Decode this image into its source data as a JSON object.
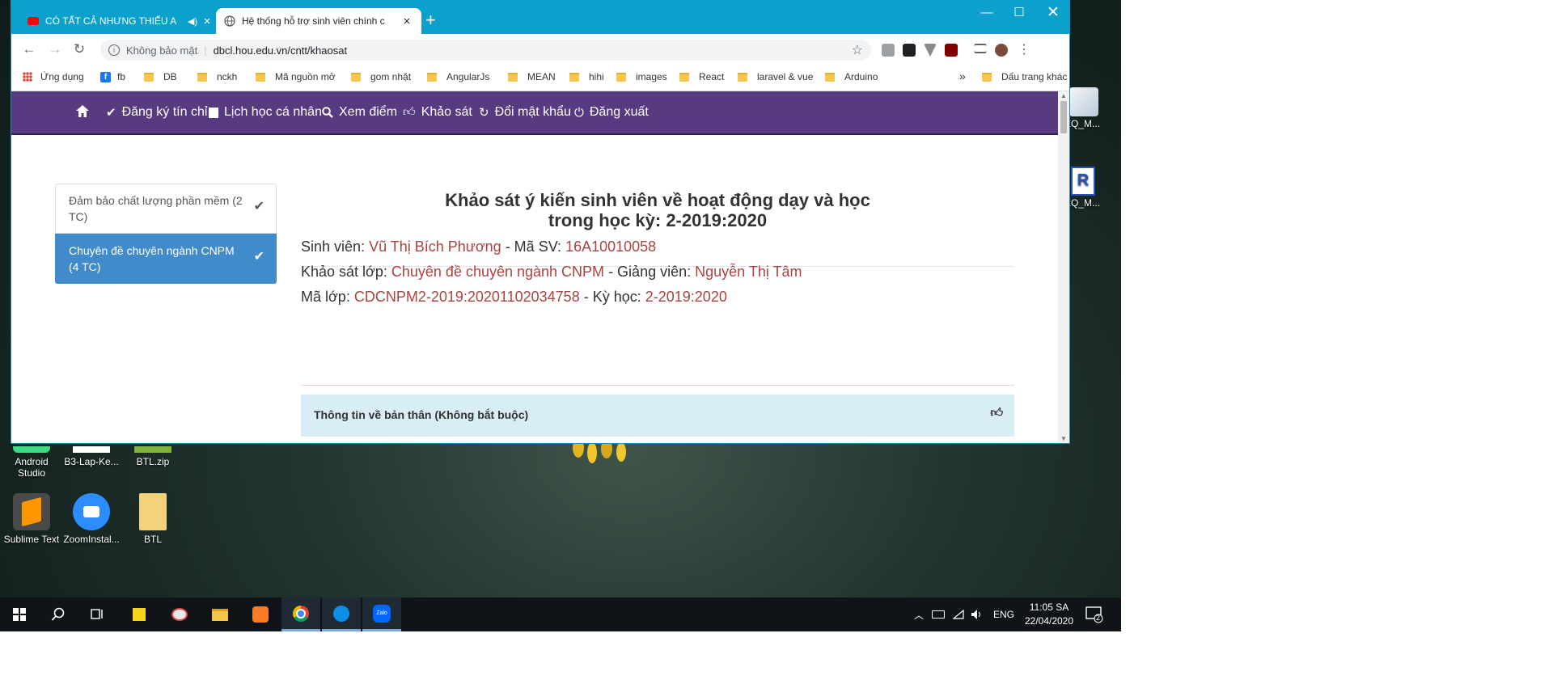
{
  "browser": {
    "tabs": [
      {
        "title": "CÓ TẤT CẢ NHƯNG THIẾU A",
        "icon": "youtube-icon",
        "active": false
      },
      {
        "title": "Hệ thống hỗ trợ sinh viên chính c",
        "icon": "globe-icon",
        "active": true
      }
    ],
    "address": {
      "security": "Không bảo mật",
      "url": "dbcl.hou.edu.vn/cntt/khaosat"
    },
    "bookmarks": [
      "Ứng dụng",
      "fb",
      "DB",
      "nckh",
      "Mã nguồn mở",
      "gom nhặt",
      "AngularJs",
      "MEAN",
      "hihi",
      "images",
      "React",
      "laravel & vue",
      "Arduino"
    ],
    "bookmarks_more": "»",
    "bookmarks_other": "Dấu trang khác"
  },
  "navbar": [
    {
      "icon": "home-icon",
      "label": ""
    },
    {
      "icon": "check-icon",
      "label": "Đăng ký tín chỉ"
    },
    {
      "icon": "calendar-icon",
      "label": "Lịch học cá nhân"
    },
    {
      "icon": "zoom-icon",
      "label": "Xem điểm"
    },
    {
      "icon": "thumbs-up-icon",
      "label": "Khảo sát"
    },
    {
      "icon": "refresh-icon",
      "label": "Đổi mật khẩu"
    },
    {
      "icon": "power-icon",
      "label": "Đăng xuất"
    }
  ],
  "sidebar": {
    "items": [
      {
        "label": "Đảm bảo chất lượng phần mềm (2 TC)",
        "checked": true,
        "active": false
      },
      {
        "label": "Chuyên đề chuyên ngành CNPM (4 TC)",
        "checked": true,
        "active": true
      }
    ]
  },
  "survey": {
    "title_line1": "Khảo sát ý kiến sinh viên về hoạt động dạy và học",
    "title_line2": "trong học kỳ: 2-2019:2020",
    "student_label": "Sinh viên:",
    "student_name": "Vũ Thị Bích Phương",
    "student_id_label": " - Mã SV:",
    "student_id": "16A10010058",
    "class_label": "Khảo sát lớp:",
    "class_name": "Chuyên đề chuyên ngành CNPM",
    "teacher_label": " - Giảng viên:",
    "teacher_name": "Nguyễn Thị Tâm",
    "class_code_label": "Mã lớp:",
    "class_code": "CDCNPM2-2019:20201102034758",
    "term_label": " - Kỳ học:",
    "term": "2-2019:2020",
    "panel_title": "Thông tin về bản thân (Không bắt buộc)"
  },
  "desktop": {
    "icons": [
      {
        "label": "Android Studio"
      },
      {
        "label": "B3-Lap-Ke..."
      },
      {
        "label": "BTL.zip"
      },
      {
        "label": "Sublime Text"
      },
      {
        "label": "ZoomInstal..."
      },
      {
        "label": "BTL"
      }
    ],
    "edge_labels": [
      "EQ_M...",
      "EQ_M..."
    ]
  },
  "taskbar": {
    "lang": "ENG",
    "time": "11:05 SA",
    "date": "22/04/2020",
    "notifications": "2"
  },
  "colors": {
    "navbar": "#573a7f",
    "accent": "#428bca",
    "value_red": "#a94442",
    "panel": "#d9edf7",
    "tabbar": "#0ca0cd"
  }
}
